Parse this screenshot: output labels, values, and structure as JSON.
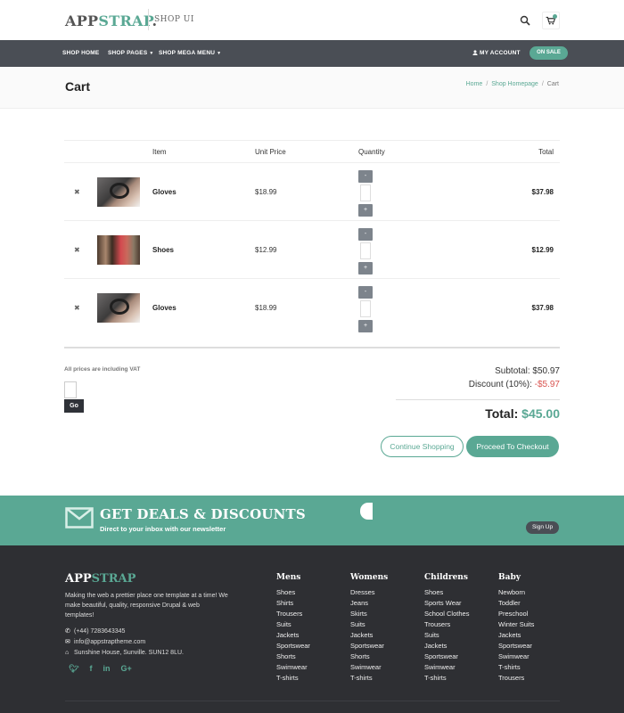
{
  "header": {
    "logo_app": "APP",
    "logo_strap": "STRAP",
    "logo_dot": ".",
    "tagline": "SHOP UI"
  },
  "nav": {
    "items": [
      "SHOP HOME",
      "SHOP PAGES",
      "SHOP MEGA MENU"
    ],
    "account": "MY ACCOUNT",
    "on_sale": "ON SALE"
  },
  "page": {
    "title": "Cart",
    "breadcrumb": [
      "Home",
      "Shop Homepage",
      "Cart"
    ]
  },
  "cart": {
    "headers": {
      "item": "Item",
      "unit_price": "Unit Price",
      "quantity": "Quantity",
      "total": "Total"
    },
    "rows": [
      {
        "name": "Gloves",
        "unit_price": "$18.99",
        "total": "$37.98"
      },
      {
        "name": "Shoes",
        "unit_price": "$12.99",
        "total": "$12.99"
      },
      {
        "name": "Gloves",
        "unit_price": "$18.99",
        "total": "$37.98"
      }
    ],
    "qty_minus": "-",
    "qty_plus": "+",
    "remove_glyph": "✖",
    "vat_note": "All prices are including VAT",
    "go_label": "Go",
    "subtotal_label": "Subtotal:",
    "subtotal_value": "$50.97",
    "discount_label": "Discount (10%):",
    "discount_value": "-$5.97",
    "total_label": "Total:",
    "total_value": "$45.00",
    "continue_label": "Continue Shopping",
    "checkout_label": "Proceed To Checkout"
  },
  "deals": {
    "title": "GET DEALS & DISCOUNTS",
    "subtitle": "Direct to your inbox with our newsletter",
    "signup_label": "Sign Up"
  },
  "footer": {
    "logo_app": "APP",
    "logo_strap": "STRAP",
    "about": "Making the web a prettier place one template at a time! We make beautiful, quality, responsive Drupal & web templates!",
    "phone": "(+44) 7283643345",
    "email": "info@appstraptheme.com",
    "address": "Sunshine House, Sunville. SUN12 8LU.",
    "columns": [
      {
        "title": "Mens",
        "items": [
          "Shoes",
          "Shirts",
          "Trousers",
          "Suits",
          "Jackets",
          "Sportswear",
          "Shorts",
          "Swimwear",
          "T-shirts"
        ]
      },
      {
        "title": "Womens",
        "items": [
          "Dresses",
          "Jeans",
          "Skirts",
          "Suits",
          "Jackets",
          "Sportswear",
          "Shorts",
          "Swimwear",
          "T-shirts"
        ]
      },
      {
        "title": "Childrens",
        "items": [
          "Shoes",
          "Sports Wear",
          "School Clothes",
          "Trousers",
          "Suits",
          "Jackets",
          "Sportswear",
          "Swimwear",
          "T-shirts"
        ]
      },
      {
        "title": "Baby",
        "items": [
          "Newborn",
          "Toddler",
          "Preschool",
          "Winter Suits",
          "Jackets",
          "Sportswear",
          "Swimwear",
          "T-shirts",
          "Trousers"
        ]
      }
    ]
  },
  "colors": {
    "accent": "#5aa894",
    "nav_bg": "#4a4e55",
    "footer_bg": "#2e2f33",
    "discount": "#d9534f"
  }
}
